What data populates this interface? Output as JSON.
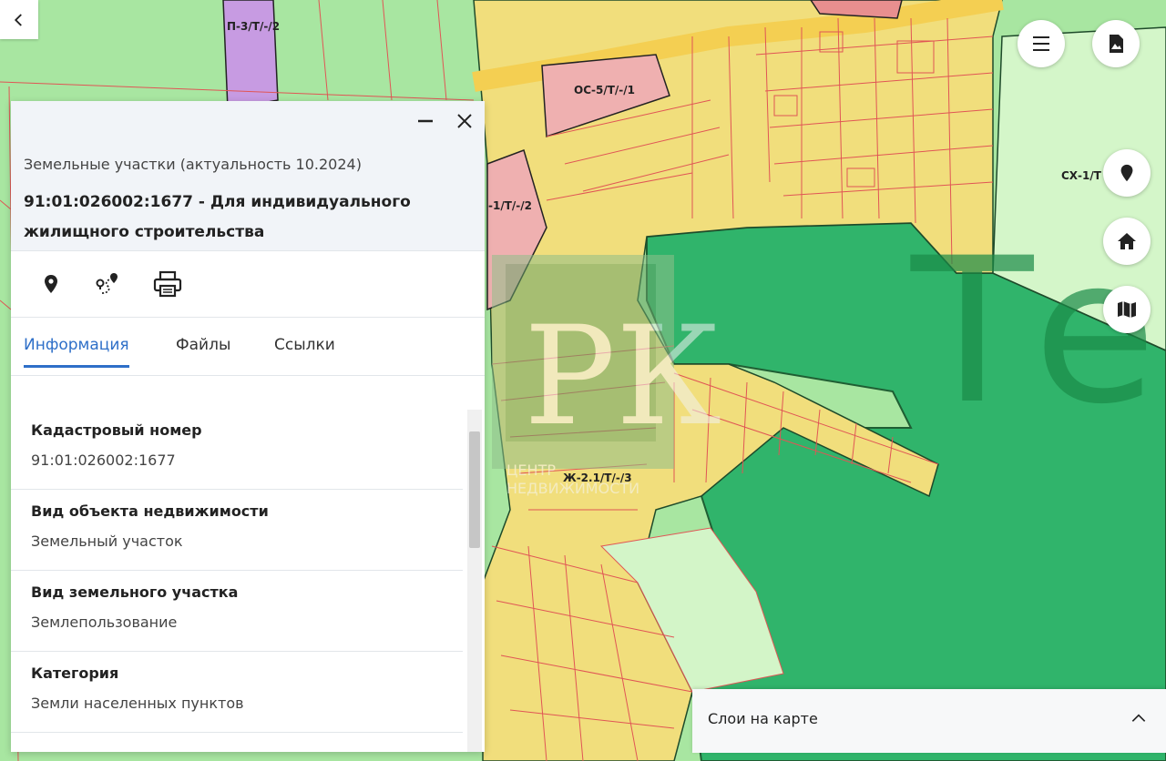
{
  "map": {
    "zone_labels": [
      "П-3/Т/-/2",
      "ОС-5/Т/-/1",
      "-1/Т/-/2",
      "СХ-1/Т",
      "Ж-2.1/Т/-/3"
    ],
    "background_text": "Тер",
    "watermark": {
      "monogram": "РК",
      "line1": "ЦЕНТР",
      "line2": "НЕДВИЖИМОСТИ"
    },
    "colors": {
      "green": "#a6e6a0",
      "dark_green": "#2fb86a",
      "yellow": "#f2e07e",
      "red_outline": "#e05555",
      "pink": "#efb0b0",
      "purple": "#c59ae0"
    }
  },
  "controls": {
    "back_icon": "chevron-left-icon",
    "menu_icon": "hamburger-menu-icon",
    "pdf_icon": "pdf-document-icon",
    "location_icon": "location-pin-icon",
    "home_icon": "home-icon",
    "map_icon": "map-icon"
  },
  "panel": {
    "layer_name": "Земельные участки (актуальность 10.2024)",
    "title": "91:01:026002:1677 - Для индивидуального жилищного строительства",
    "actions": [
      "location-pin-icon",
      "route-icon",
      "print-icon"
    ],
    "tabs": [
      {
        "label": "Информация",
        "active": true
      },
      {
        "label": "Файлы",
        "active": false
      },
      {
        "label": "Ссылки",
        "active": false
      }
    ],
    "fields": [
      {
        "label": "Кадастровый номер",
        "value": "91:01:026002:1677"
      },
      {
        "label": "Вид объекта недвижимости",
        "value": "Земельный участок"
      },
      {
        "label": "Вид земельного участка",
        "value": "Землепользование"
      },
      {
        "label": "Категория",
        "value": "Земли населенных пунктов"
      }
    ]
  },
  "layers_bar": {
    "label": "Слои на карте"
  }
}
